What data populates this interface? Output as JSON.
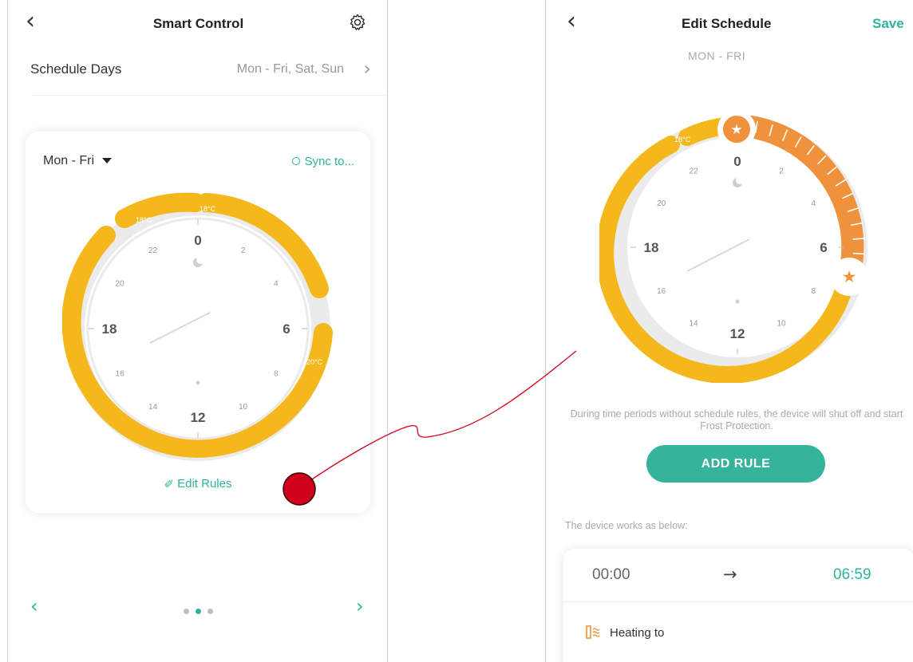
{
  "left_screen": {
    "header": {
      "title": "Smart Control",
      "back_icon": "chevron-left-icon",
      "settings_icon": "gear-icon"
    },
    "schedule_days": {
      "label": "Schedule Days",
      "value": "Mon - Fri, Sat, Sun"
    },
    "card": {
      "day_selector": "Mon - Fri",
      "sync_label": "Sync to...",
      "dial": {
        "hour_labels": [
          "0",
          "2",
          "4",
          "6",
          "8",
          "10",
          "12",
          "14",
          "16",
          "18",
          "20",
          "22"
        ],
        "segment_labels": [
          "18°C",
          "18°C",
          "20°C"
        ],
        "ring_color": "#f4b71c"
      },
      "edit_rules_label": "Edit Rules"
    },
    "pager": {
      "pages": 3,
      "active": 2
    }
  },
  "right_screen": {
    "header": {
      "title": "Edit Schedule",
      "save_label": "Save",
      "back_icon": "chevron-left-icon"
    },
    "subtitle": "MON - FRI",
    "dial": {
      "hour_labels": [
        "0",
        "2",
        "4",
        "6",
        "8",
        "10",
        "12",
        "14",
        "16",
        "18",
        "20",
        "22"
      ],
      "segment_label": "18°C",
      "active_color": "#f0923b",
      "ring_color": "#f4b71c"
    },
    "note": "During time periods without schedule rules, the device will shut off and start Frost Protection.",
    "add_rule_label": "ADD RULE",
    "works_below_label": "The device works as below:",
    "rule": {
      "start": "00:00",
      "arrow": "→",
      "end": "06:59",
      "heating_label": "Heating to"
    }
  },
  "colors": {
    "accent": "#2fb39a",
    "yellow": "#f4b71c",
    "orange": "#f0923b",
    "annotation": "#d0021b"
  }
}
